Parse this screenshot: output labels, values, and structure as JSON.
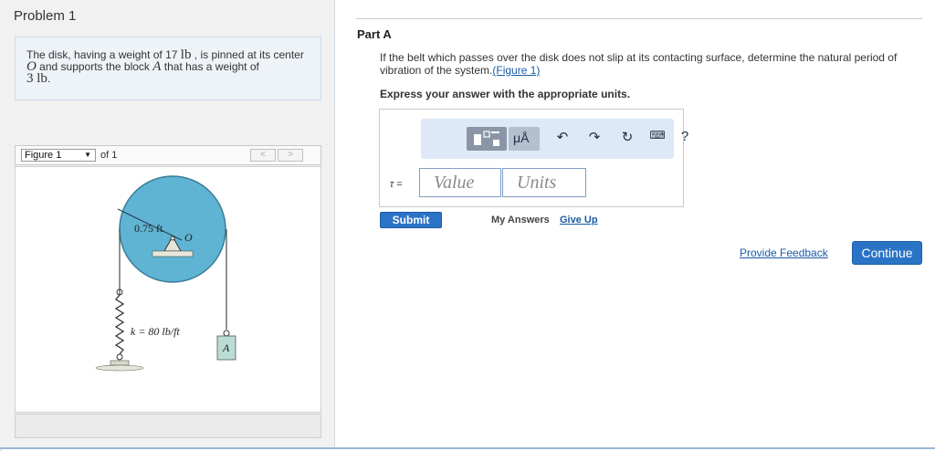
{
  "problem": {
    "title": "Problem 1",
    "text_part1": "The disk, having a weight of 17 ",
    "unit_lb": "lb",
    "text_part2": " , is pinned at its center ",
    "var_O": "O",
    "text_part3": " and supports the block ",
    "var_A": "A",
    "text_part4": " that has a weight of",
    "weight_block": "3 lb",
    "period": "."
  },
  "figure": {
    "selected": "Figure 1",
    "of_label": "of 1",
    "prev_label": "<",
    "next_label": ">",
    "radius_label": "0.75 ft",
    "center_label": "O",
    "spring_label": "k = 80 lb/ft",
    "block_label": "A"
  },
  "part": {
    "title": "Part A",
    "question_text": "If the belt which passes over the disk does not slip at its contacting surface, determine the natural period of vibration of the system.",
    "figure_link": "(Figure 1)",
    "instruction": "Express your answer with the appropriate units."
  },
  "answer": {
    "var_label": "τ =",
    "value_placeholder": "Value",
    "units_placeholder": "Units",
    "toolbar": {
      "units_symbol": "μÅ",
      "undo_icon": "undo-icon",
      "redo_icon": "redo-icon",
      "reset_icon": "reset-icon",
      "keyboard_icon": "keyboard-icon",
      "help_label": "?"
    }
  },
  "actions": {
    "submit": "Submit",
    "my_answers": "My Answers",
    "give_up": "Give Up",
    "provide_feedback": "Provide Feedback",
    "continue": "Continue"
  },
  "colors": {
    "accent": "#2a73c5",
    "link": "#1a5aa5",
    "disk": "#5fb3d3",
    "block": "#b9ddd4"
  }
}
